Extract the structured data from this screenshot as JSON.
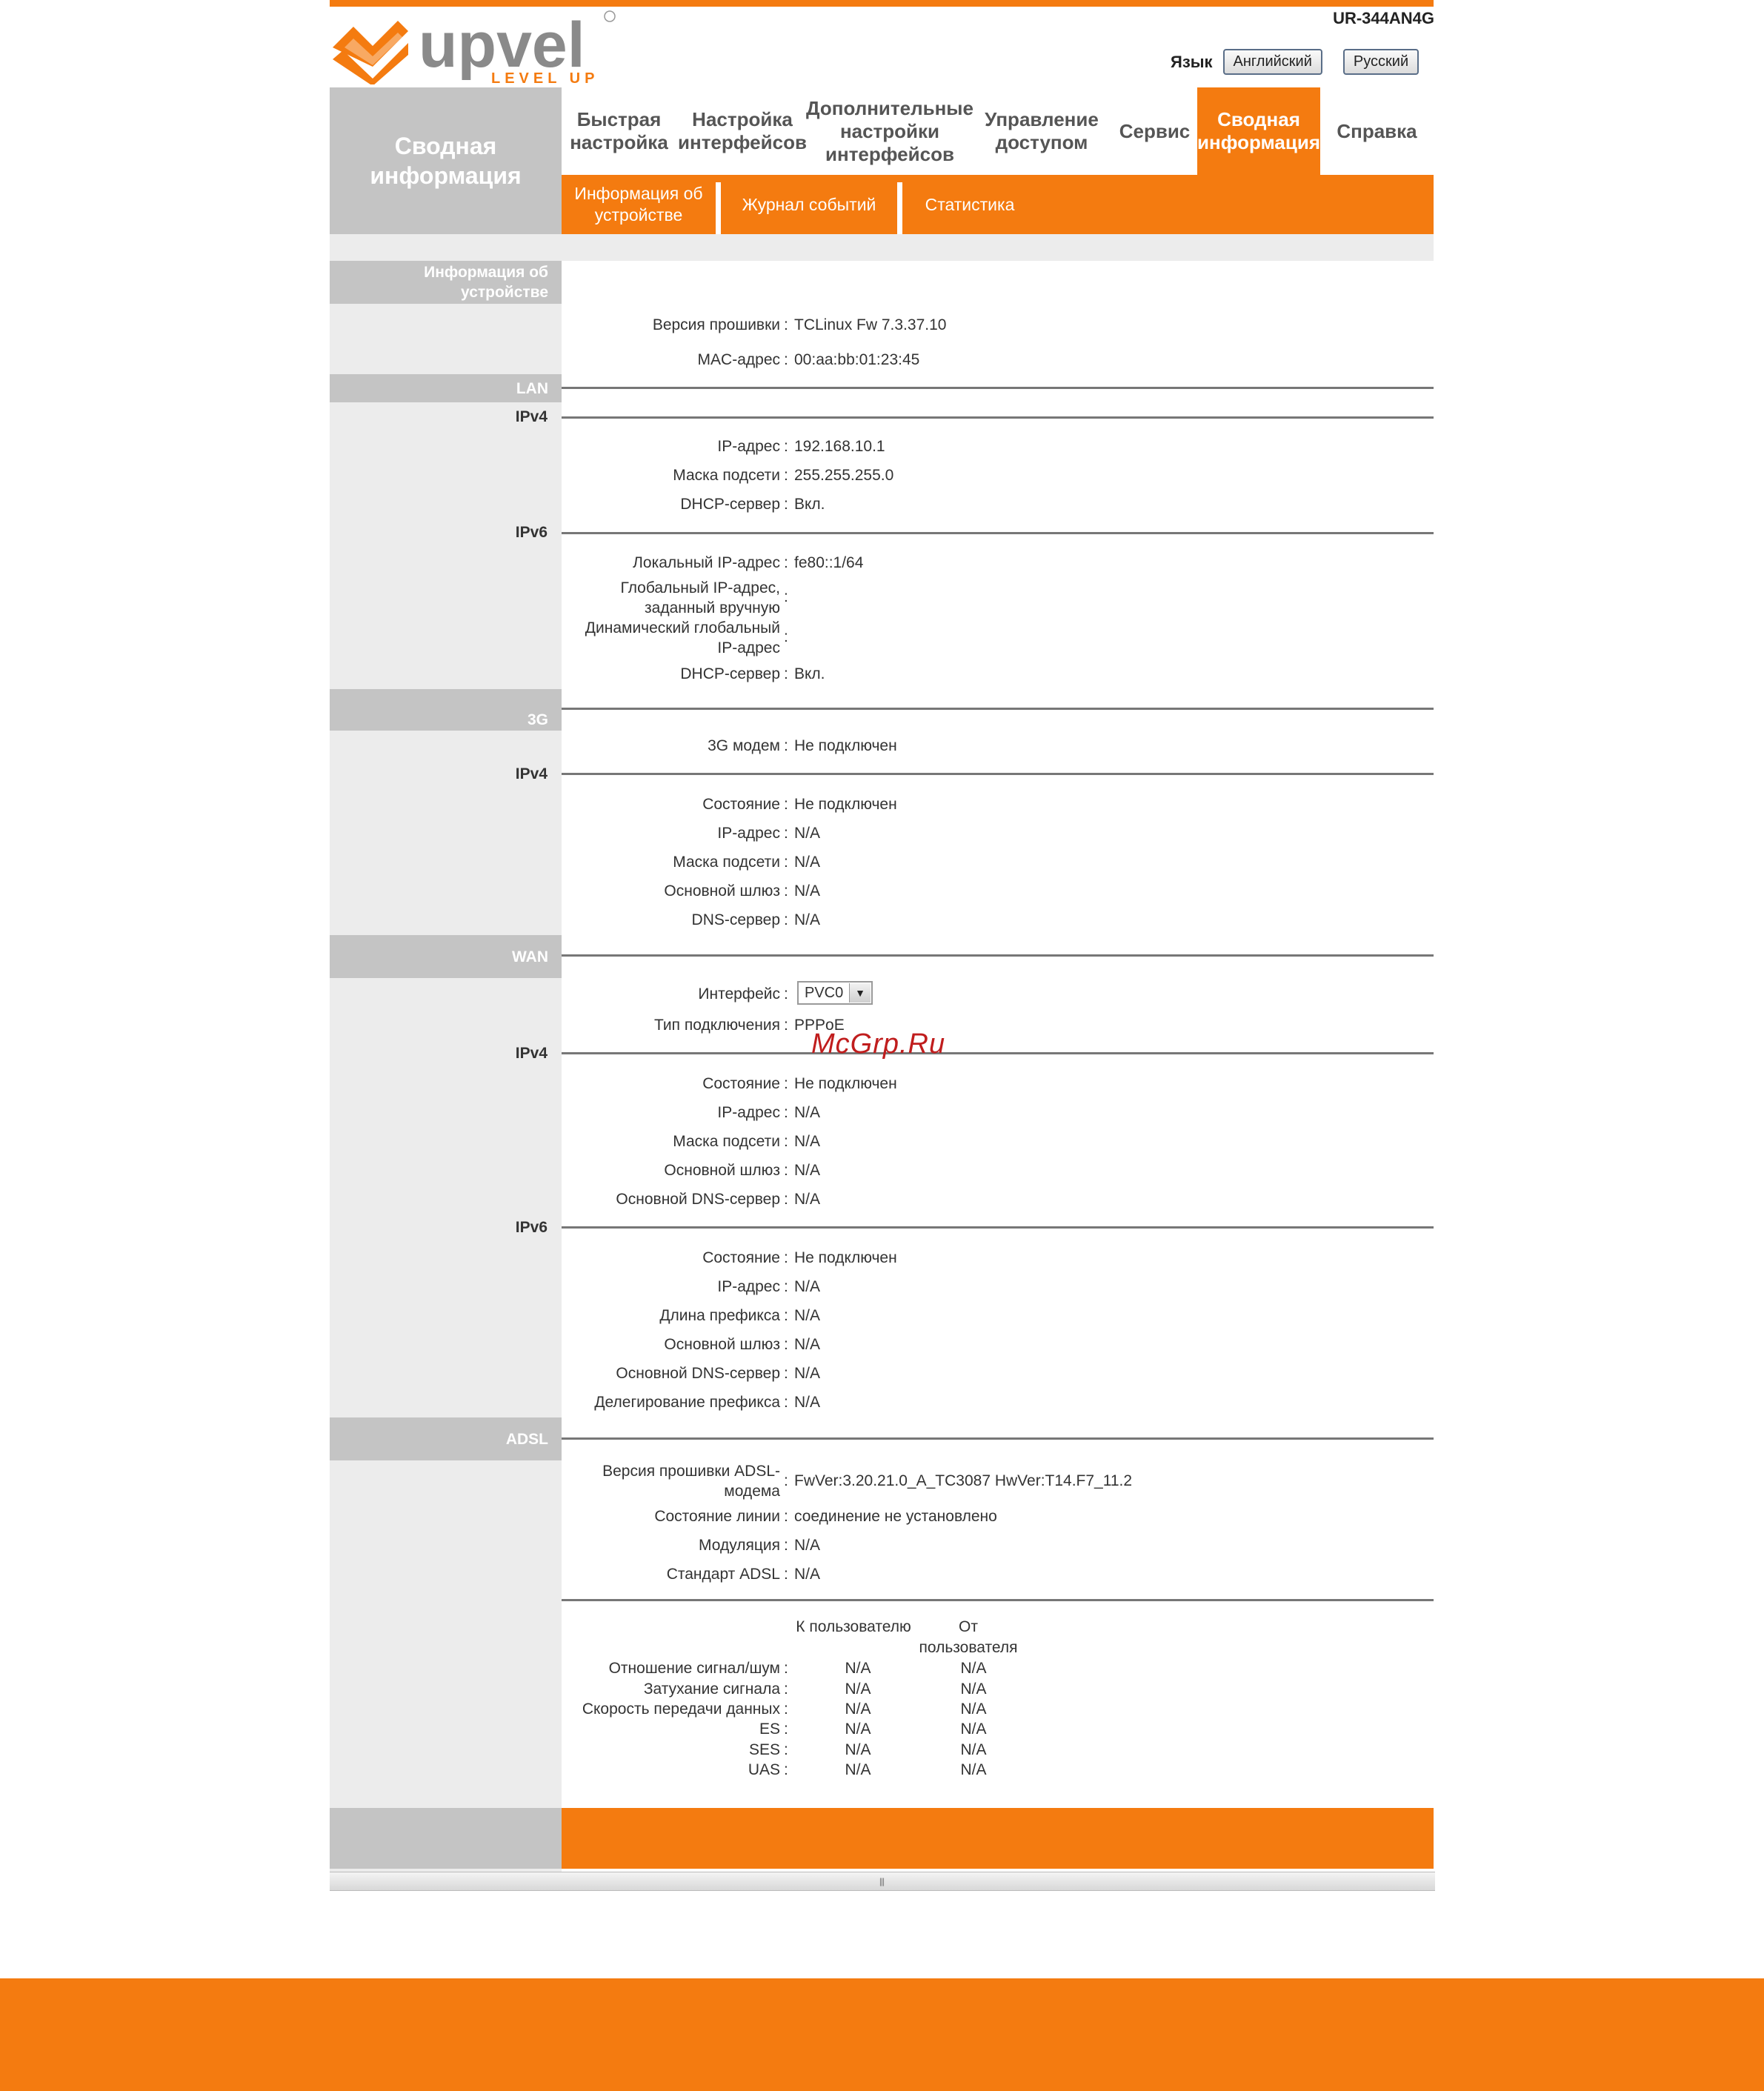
{
  "header": {
    "brand": "upvel",
    "tagline": "LEVEL UP",
    "model": "UR-344AN4G",
    "language_label": "Язык",
    "lang_buttons": [
      "Английский",
      "Русский"
    ]
  },
  "sidebar": {
    "title": "Сводная информация"
  },
  "nav": [
    "Быстрая настройка",
    "Настройка интерфейсов",
    "Дополнительные настройки интерфейсов",
    "Управление доступом",
    "Сервис",
    "Сводная информация",
    "Справка"
  ],
  "active_nav": "Сводная информация",
  "subnav": [
    "Информация об устройстве",
    "Журнал событий",
    "Статистика"
  ],
  "sections": {
    "device": {
      "title": "Информация об устройстве",
      "firmware_label": "Версия прошивки",
      "firmware": "TCLinux Fw 7.3.37.10",
      "mac_label": "MAC-адрес",
      "mac": "00:aa:bb:01:23:45"
    },
    "lan": {
      "title": "LAN",
      "ipv4": "IPv4",
      "ip_label": "IP-адрес",
      "ip": "192.168.10.1",
      "mask_label": "Маска подсети",
      "mask": "255.255.255.0",
      "dhcp_label": "DHCP-сервер",
      "dhcp": "Вкл.",
      "ipv6": "IPv6",
      "local_ip_label": "Локальный IP-адрес",
      "local_ip": "fe80::1/64",
      "global_manual_label": "Глобальный IP-адрес, заданный вручную",
      "global_manual": "",
      "dynamic_global_label": "Динамический глобальный IP-адрес",
      "dynamic_global": "",
      "dhcp6_label": "DHCP-сервер",
      "dhcp6": "Вкл."
    },
    "g3": {
      "title": "3G",
      "modem_label": "3G модем",
      "modem": "Не подключен",
      "ipv4": "IPv4",
      "state_label": "Состояние",
      "state": "Не подключен",
      "ip_label": "IP-адрес",
      "ip": "N/A",
      "mask_label": "Маска подсети",
      "mask": "N/A",
      "gw_label": "Основной шлюз",
      "gw": "N/A",
      "dns_label": "DNS-сервер",
      "dns": "N/A"
    },
    "wan": {
      "title": "WAN",
      "iface_label": "Интерфейс",
      "iface": "PVC0",
      "conn_label": "Тип подключения",
      "conn": "PPPoE",
      "ipv4": "IPv4",
      "state_label": "Состояние",
      "state": "Не подключен",
      "ip_label": "IP-адрес",
      "ip": "N/A",
      "mask_label": "Маска подсети",
      "mask": "N/A",
      "gw_label": "Основной шлюз",
      "gw": "N/A",
      "dns_label": "Основной DNS-сервер",
      "dns": "N/A",
      "ipv6": "IPv6",
      "state6_label": "Состояние",
      "state6": "Не подключен",
      "ip6_label": "IP-адрес",
      "ip6": "N/A",
      "prefix_len_label": "Длина префикса",
      "prefix_len": "N/A",
      "gw6_label": "Основной шлюз",
      "gw6": "N/A",
      "dns6_label": "Основной DNS-сервер",
      "dns6": "N/A",
      "prefix_deleg_label": "Делегирование префикса",
      "prefix_deleg": "N/A"
    },
    "adsl": {
      "title": "ADSL",
      "fw_label": "Версия прошивки ADSL-модема",
      "fw": "FwVer:3.20.21.0_A_TC3087 HwVer:T14.F7_11.2",
      "line_label": "Состояние линии",
      "line": "соединение не установлено",
      "mod_label": "Модуляция",
      "mod": "N/A",
      "std_label": "Стандарт ADSL",
      "std": "N/A",
      "col_down": "К пользователю",
      "col_up": "От пользователя",
      "stats": [
        {
          "label": "Отношение сигнал/шум",
          "down": "N/A",
          "up": "N/A"
        },
        {
          "label": "Затухание сигнала",
          "down": "N/A",
          "up": "N/A"
        },
        {
          "label": "Скорость передачи данных",
          "down": "N/A",
          "up": "N/A"
        },
        {
          "label": "ES",
          "down": "N/A",
          "up": "N/A"
        },
        {
          "label": "SES",
          "down": "N/A",
          "up": "N/A"
        },
        {
          "label": "UAS",
          "down": "N/A",
          "up": "N/A"
        }
      ]
    }
  },
  "watermark": "McGrp.Ru",
  "colors": {
    "accent": "#f47b10",
    "panel_gray": "#c4c4c4",
    "sidebar_gray": "#ececec"
  }
}
